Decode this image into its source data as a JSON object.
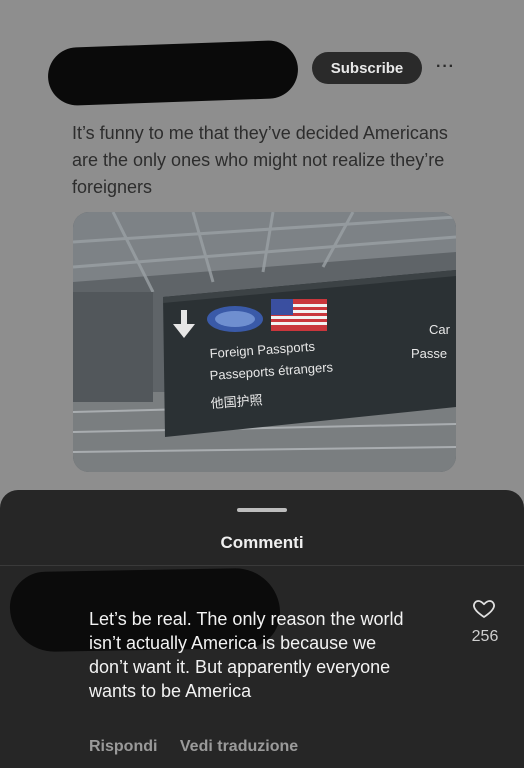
{
  "post": {
    "subscribe_label": "Subscribe",
    "more_label": "···",
    "text": "It’s funny to me that they’ve decided Americans are the only ones who might not realize they’re foreigners"
  },
  "image": {
    "sign_line1": "Foreign Passports",
    "sign_line2": "Passeports étrangers",
    "sign_line3": "他国护照",
    "sign_right_top": "Car",
    "sign_right_bottom": "Passe"
  },
  "comments_sheet": {
    "title": "Commenti",
    "comment": {
      "text": "Let’s be real. The only reason the world isn’t actually America is because we don’t want it. But apparently everyone wants to be America",
      "likes": "256",
      "reply_label": "Rispondi",
      "translate_label": "Vedi traduzione"
    }
  },
  "colors": {
    "sheet_bg": "#262626",
    "overlay_bg": "#8e8e8e",
    "sign_bg": "#2b3134"
  }
}
